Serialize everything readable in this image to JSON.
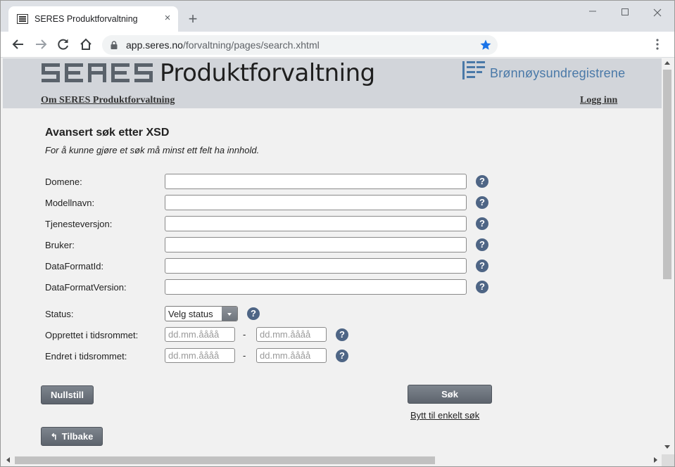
{
  "browser": {
    "tab_title": "SERES Produktforvaltning",
    "tab_close": "×",
    "new_tab": "+",
    "url_host": "app.seres.no",
    "url_path": "/forvaltning/pages/search.xhtml"
  },
  "banner": {
    "title": "Produktforvaltning",
    "brreg": "Brønnøysundregistrene",
    "about_link": "Om SERES Produktforvaltning",
    "login_link": "Logg inn"
  },
  "form": {
    "heading": "Avansert søk etter XSD",
    "subheading": "For å kunne gjøre et søk må minst ett felt ha innhold.",
    "fields": [
      {
        "label": "Domene:",
        "value": ""
      },
      {
        "label": "Modellnavn:",
        "value": ""
      },
      {
        "label": "Tjenesteversjon:",
        "value": ""
      },
      {
        "label": "Bruker:",
        "value": ""
      },
      {
        "label": "DataFormatId:",
        "value": ""
      },
      {
        "label": "DataFormatVersion:",
        "value": ""
      }
    ],
    "status_label": "Status:",
    "status_value": "Velg status",
    "created_label": "Opprettet i tidsrommet:",
    "changed_label": "Endret i tidsrommet:",
    "date_placeholder": "dd.mm.åååå",
    "dash": "-",
    "help_glyph": "?",
    "reset_button": "Nullstill",
    "search_button": "Søk",
    "switch_link": "Bytt til enkelt søk",
    "back_button": "Tilbake"
  }
}
